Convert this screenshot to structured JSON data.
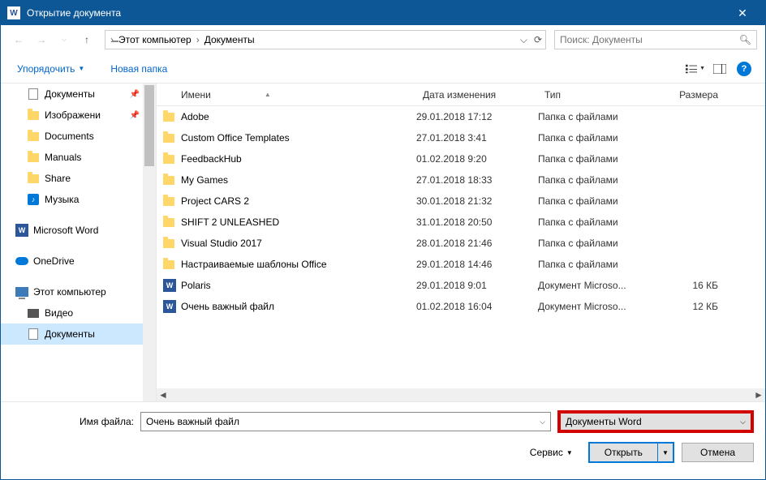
{
  "window": {
    "title": "Открытие документа"
  },
  "path": {
    "root_icon": "pc",
    "segments": [
      "Этот компьютер",
      "Документы"
    ]
  },
  "search": {
    "placeholder": "Поиск: Документы"
  },
  "toolbar": {
    "organize": "Упорядочить",
    "newfolder": "Новая папка"
  },
  "sidebar": {
    "quick": [
      {
        "label": "Документы",
        "icon": "doc",
        "pinned": true
      },
      {
        "label": "Изображени",
        "icon": "folder",
        "pinned": true
      },
      {
        "label": "Documents",
        "icon": "folder",
        "pinned": false
      },
      {
        "label": "Manuals",
        "icon": "folder",
        "pinned": false
      },
      {
        "label": "Share",
        "icon": "folder",
        "pinned": false
      },
      {
        "label": "Музыка",
        "icon": "music",
        "pinned": false
      }
    ],
    "word": "Microsoft Word",
    "onedrive": "OneDrive",
    "thispc": "Этот компьютер",
    "pcitems": [
      {
        "label": "Видео",
        "icon": "video",
        "selected": false
      },
      {
        "label": "Документы",
        "icon": "doc",
        "selected": true
      }
    ]
  },
  "columns": {
    "name": "Имени",
    "date": "Дата изменения",
    "type": "Тип",
    "size": "Размера"
  },
  "files": [
    {
      "name": "Adobe",
      "date": "29.01.2018 17:12",
      "type": "Папка с файлами",
      "size": "",
      "icon": "folder"
    },
    {
      "name": "Custom Office Templates",
      "date": "27.01.2018 3:41",
      "type": "Папка с файлами",
      "size": "",
      "icon": "folder"
    },
    {
      "name": "FeedbackHub",
      "date": "01.02.2018 9:20",
      "type": "Папка с файлами",
      "size": "",
      "icon": "folder"
    },
    {
      "name": "My Games",
      "date": "27.01.2018 18:33",
      "type": "Папка с файлами",
      "size": "",
      "icon": "folder"
    },
    {
      "name": "Project CARS 2",
      "date": "30.01.2018 21:32",
      "type": "Папка с файлами",
      "size": "",
      "icon": "folder"
    },
    {
      "name": "SHIFT 2 UNLEASHED",
      "date": "31.01.2018 20:50",
      "type": "Папка с файлами",
      "size": "",
      "icon": "folder"
    },
    {
      "name": "Visual Studio 2017",
      "date": "28.01.2018 21:46",
      "type": "Папка с файлами",
      "size": "",
      "icon": "folder"
    },
    {
      "name": "Настраиваемые шаблоны Office",
      "date": "29.01.2018 14:46",
      "type": "Папка с файлами",
      "size": "",
      "icon": "folder"
    },
    {
      "name": "Polaris",
      "date": "29.01.2018 9:01",
      "type": "Документ Microso...",
      "size": "16 КБ",
      "icon": "word"
    },
    {
      "name": "Очень важный файл",
      "date": "01.02.2018 16:04",
      "type": "Документ Microso...",
      "size": "12 КБ",
      "icon": "word"
    }
  ],
  "form": {
    "filename_label": "Имя файла:",
    "filename_value": "Очень важный файл",
    "filter_value": "Документы Word",
    "tools": "Сервис",
    "open": "Открыть",
    "cancel": "Отмена"
  }
}
